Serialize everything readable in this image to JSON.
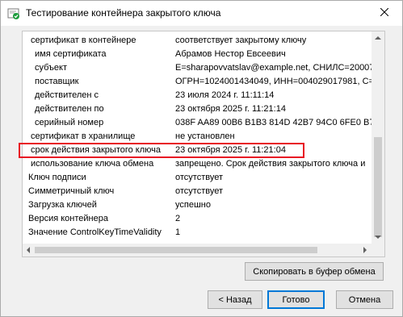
{
  "window": {
    "title": "Тестирование контейнера закрытого ключа"
  },
  "details": [
    {
      "key": "сертификат в контейнере",
      "value": "соответствует закрытому ключу",
      "indent": 1
    },
    {
      "key": "имя сертификата",
      "value": "Абрамов Нестор Евсеевич",
      "indent": 2
    },
    {
      "key": "субъект",
      "value": "E=sharapovvatslav@example.net, СНИЛС=20007",
      "indent": 2
    },
    {
      "key": "поставщик",
      "value": "ОГРН=1024001434049, ИНН=004029017981, С=",
      "indent": 2
    },
    {
      "key": "действителен с",
      "value": "23 июля 2024 г. 11:11:14",
      "indent": 2
    },
    {
      "key": "действителен по",
      "value": "23 октября 2025 г. 11:21:14",
      "indent": 2
    },
    {
      "key": "серийный номер",
      "value": "038F AA89 00B6 B1B3 814D 42B7 94C0 6FE0 B7",
      "indent": 2
    },
    {
      "key": "сертификат в хранилище",
      "value": "не установлен",
      "indent": 1
    },
    {
      "key": "срок действия закрытого ключа",
      "value": "23 октября 2025 г. 11:21:04",
      "indent": 1
    },
    {
      "key": "использование ключа обмена",
      "value": "запрещено. Срок действия закрытого ключа и",
      "indent": 1
    },
    {
      "key": "Ключ подписи",
      "value": "отсутствует",
      "indent": 0
    },
    {
      "key": "Симметричный ключ",
      "value": "отсутствует",
      "indent": 0
    },
    {
      "key": "Загрузка ключей",
      "value": "успешно",
      "indent": 0
    },
    {
      "key": "Версия контейнера",
      "value": "2",
      "indent": 0
    },
    {
      "key": "Значение ControlKeyTimeValidity",
      "value": "1",
      "indent": 0
    }
  ],
  "buttons": {
    "copy": "Скопировать в буфер обмена",
    "back": "< Назад",
    "done": "Готово",
    "cancel": "Отмена"
  },
  "colors": {
    "highlight": "#e81123",
    "primary_border": "#0078d7"
  },
  "icons": {
    "title": "certificate-check-icon",
    "close": "close-icon"
  }
}
